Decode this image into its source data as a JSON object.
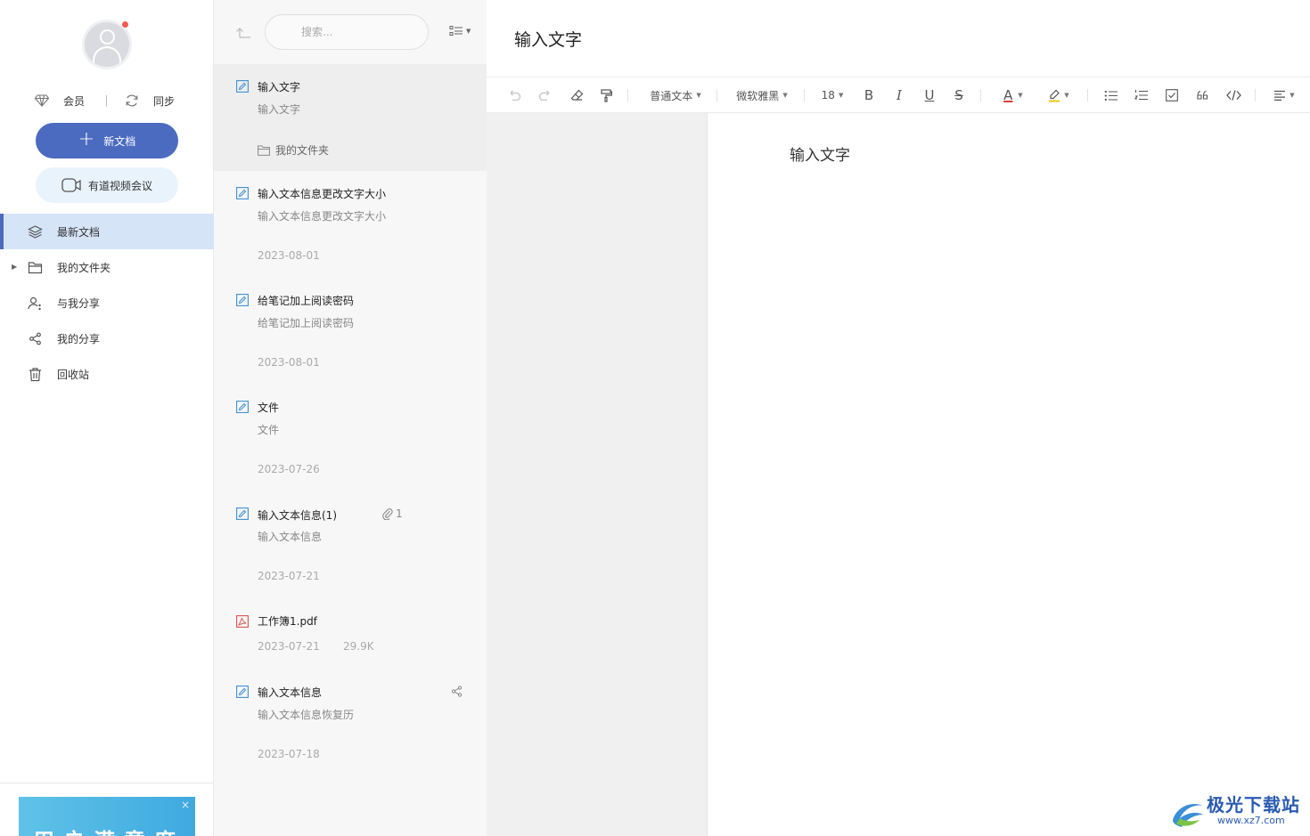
{
  "sidebar": {
    "member_label": "会员",
    "sync_label": "同步",
    "new_doc_label": "新文档",
    "meeting_label": "有道视频会议",
    "nav": [
      {
        "label": "最新文档",
        "icon": "layers-icon"
      },
      {
        "label": "我的文件夹",
        "icon": "folder-icon"
      },
      {
        "label": "与我分享",
        "icon": "user-share-icon"
      },
      {
        "label": "我的分享",
        "icon": "share-icon"
      },
      {
        "label": "回收站",
        "icon": "trash-icon"
      }
    ],
    "ad_text": "用户满意度",
    "ad_close": "×"
  },
  "list": {
    "search_placeholder": "搜索...",
    "docs": [
      {
        "title": "输入文字",
        "snippet": "输入文字",
        "folder": "我的文件夹",
        "type": "note"
      },
      {
        "title": "输入文本信息更改文字大小",
        "snippet": "输入文本信息更改文字大小",
        "date": "2023-08-01",
        "type": "note"
      },
      {
        "title": "给笔记加上阅读密码",
        "snippet": "给笔记加上阅读密码",
        "date": "2023-08-01",
        "type": "note"
      },
      {
        "title": "文件",
        "snippet": "文件",
        "date": "2023-07-26",
        "type": "note"
      },
      {
        "title": "输入文本信息(1)",
        "snippet": "输入文本信息",
        "date": "2023-07-21",
        "attachments": "1",
        "type": "note"
      },
      {
        "title": "工作簿1.pdf",
        "date": "2023-07-21",
        "size": "29.9K",
        "type": "pdf"
      },
      {
        "title": "输入文本信息",
        "snippet": "输入文本信息恢复历",
        "date": "2023-07-18",
        "type": "note",
        "shared": true
      }
    ]
  },
  "editor": {
    "title": "输入文字",
    "body": "输入文字",
    "toolbar": {
      "paragraph_style": "普通文本",
      "font_family": "微软雅黑",
      "font_size": "18",
      "bold": "B",
      "italic": "I",
      "underline": "U",
      "strike": "S",
      "font_color": "A"
    }
  },
  "watermark": {
    "title": "极光下载站",
    "url": "www.xz7.com"
  },
  "colors": {
    "accent": "#4a6bc0",
    "active_nav_bg": "#d6e4f8",
    "note_icon": "#3f8fd2",
    "pdf_icon": "#d9534f",
    "font_color_bar": "#e03b3b",
    "highlight_bar": "#f5c518"
  }
}
